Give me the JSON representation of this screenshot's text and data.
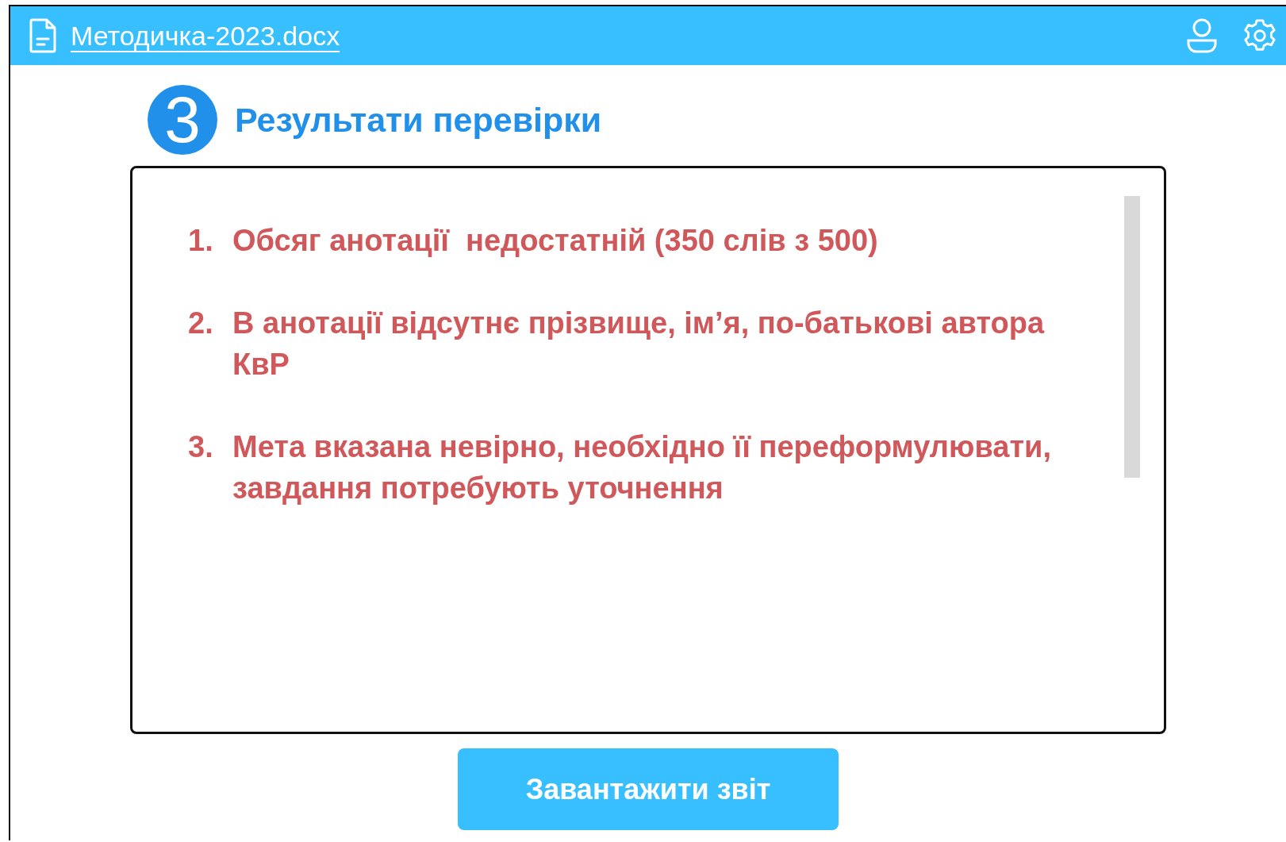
{
  "header": {
    "file_name": "Методичка-2023.docx"
  },
  "step": {
    "number": "3",
    "title": "Результати перевірки"
  },
  "results": [
    {
      "number": "1.",
      "text": "Обсяг анотації  недостатній (350 слів з 500)"
    },
    {
      "number": "2.",
      "text": "В анотації відсутнє прізвище, ім’я, по-батькові автора КвР"
    },
    {
      "number": "3.",
      "text": "Мета вказана невірно, необхідно її переформулювати, завдання потребують уточнення"
    }
  ],
  "download_button": "Завантажити звіт"
}
